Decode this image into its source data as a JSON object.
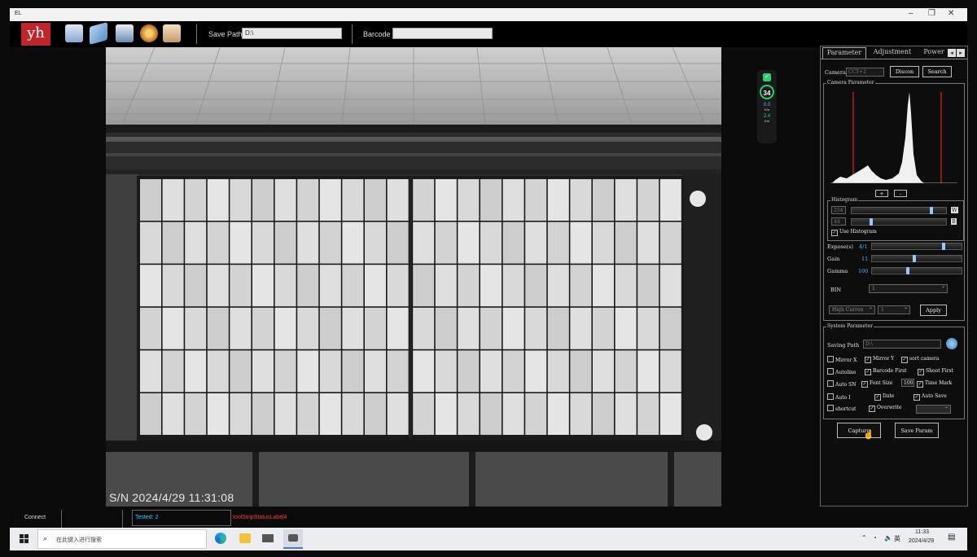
{
  "window": {
    "title": "EL",
    "controls": [
      "minimize",
      "maximize",
      "close"
    ]
  },
  "toolbar": {
    "logo_text": "yh",
    "icons": [
      "camera-icon",
      "scanner-icon",
      "save-icon",
      "settings-gear-icon",
      "report-icon"
    ],
    "save_path_label": "Save Path",
    "save_path_value": "D:\\",
    "barcode_label": "Barcode",
    "barcode_value": ""
  },
  "image": {
    "serial_text": "S/N  2024/4/29 11:31:08"
  },
  "sys_widget": {
    "percent": "34",
    "percent_unit": "%",
    "upload": "0.0",
    "download": "2.4",
    "rate_unit": "K/s"
  },
  "tabs": [
    "Parameter",
    "Adjustment",
    "Power"
  ],
  "camera": {
    "label": "Camera",
    "value": "CCT+2",
    "button_disconn": "Discon",
    "button_search": "Search"
  },
  "camera_parameter": {
    "title": "Camera Parameter",
    "hist_buttons": [
      "+",
      "-"
    ],
    "histogram_group": "Histogram",
    "histogram_values": [
      "254",
      "44"
    ],
    "histogram_tags": [
      "W",
      "B"
    ],
    "use_histogram_label": "Use Histogram",
    "expose_label": "Expose(s)",
    "expose_value": "4/1",
    "gain_label": "Gain",
    "gain_value": "11",
    "gamma_label": "Gamma",
    "gamma_value": "100",
    "bin_label": "BIN",
    "bin_value": "1",
    "mode_value": "High Curren",
    "mode_sub": "1",
    "apply_label": "Apply"
  },
  "system_parameter": {
    "title": "System Parameter",
    "saving_path_label": "Saving Path",
    "saving_path_value": "D:\\",
    "checkboxes": [
      {
        "label": "Mirror X",
        "checked": false
      },
      {
        "label": "Mirror Y",
        "checked": true
      },
      {
        "label": "sort camera",
        "checked": true
      },
      {
        "label": "Autoline",
        "checked": false
      },
      {
        "label": "Barcode First",
        "checked": true
      },
      {
        "label": "Shoot First",
        "checked": true
      },
      {
        "label": "Auto SN",
        "checked": false
      },
      {
        "label": "Font Size",
        "checked": true
      },
      {
        "label": "Time Mark",
        "checked": true
      },
      {
        "label": "Auto I",
        "checked": false
      },
      {
        "label": "Date",
        "checked": true
      },
      {
        "label": "Auto Save",
        "checked": true
      },
      {
        "label": "shortcut",
        "checked": false
      },
      {
        "label": "Overwrite",
        "checked": true
      }
    ],
    "font_size_value": "100"
  },
  "actions": {
    "capture": "Capture",
    "save_param": "Save Param"
  },
  "status": {
    "connect": "Connect",
    "tested": "Tested: 2",
    "label4": "toolStripStatusLabel4"
  },
  "taskbar": {
    "search_placeholder": "在此键入进行搜索",
    "ime": "英",
    "time": "11:33",
    "date": "2024/4/29",
    "colors": {
      "accent": "#c0252b",
      "tested": "#3ec6ff",
      "status_red": "#ff3b3b"
    }
  }
}
